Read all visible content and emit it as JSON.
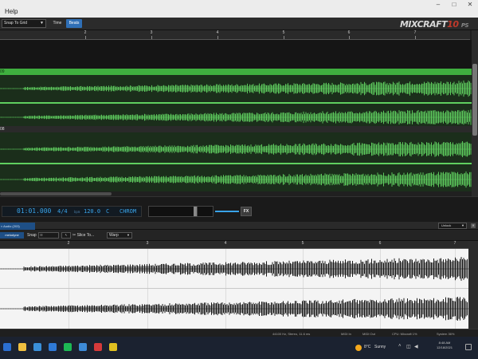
{
  "window": {
    "menu_label": "Help",
    "minimize": "–",
    "maximize": "□",
    "close": "✕"
  },
  "toolbar": {
    "snap_value": "Snap To Grid",
    "time_label": "Time",
    "beats_label": "Beats"
  },
  "logo": {
    "text": "MIXCRAFT",
    "version": "10",
    "edition": "PS"
  },
  "ruler": {
    "labels": [
      "2",
      "3",
      "4",
      "5",
      "6",
      "7",
      "8"
    ]
  },
  "tracks": {
    "lane_labels": [
      "09",
      "08"
    ]
  },
  "transport": {
    "time": "01:01.000",
    "signature": "4/4",
    "bpm_label": "bpm",
    "tempo": "120.0",
    "key": "C",
    "scale": "CHROM",
    "fx_label": "FX"
  },
  "editor": {
    "tab_label": "≈ Audio (203)",
    "unlock_label": "Unlock",
    "close_label": "✕",
    "melodyne_label": "melodyne",
    "snap_label": "Snap",
    "snap_value": "☷",
    "tool_value": "↖",
    "slice_label": "✂ Slice To...",
    "warp_label": "Warp",
    "ruler_labels": [
      "2",
      "3",
      "4",
      "5",
      "6",
      "7"
    ]
  },
  "status": {
    "format": "44100 Hz, Stereo, 11.6 ms",
    "midi_in": "MIDI In",
    "midi_out": "MIDI Out",
    "cpu": "CPU: Mixcraft 1%",
    "system": "System 36%"
  },
  "taskbar": {
    "temp": "8°C",
    "condition": "Sunny",
    "time": "8:48 AM",
    "date": "12/18/2021",
    "icon_colors": [
      "#2b6fd1",
      "#f0c040",
      "#3a8fd8",
      "#2f7ad8",
      "#1db954",
      "#3d8bd8",
      "#d63a3a",
      "#e0c020"
    ]
  },
  "colors": {
    "accent_blue": "#39a3e8",
    "clip_green": "#3fae3f",
    "wave_green": "#5cc85c",
    "record_red": "#c0392b"
  }
}
